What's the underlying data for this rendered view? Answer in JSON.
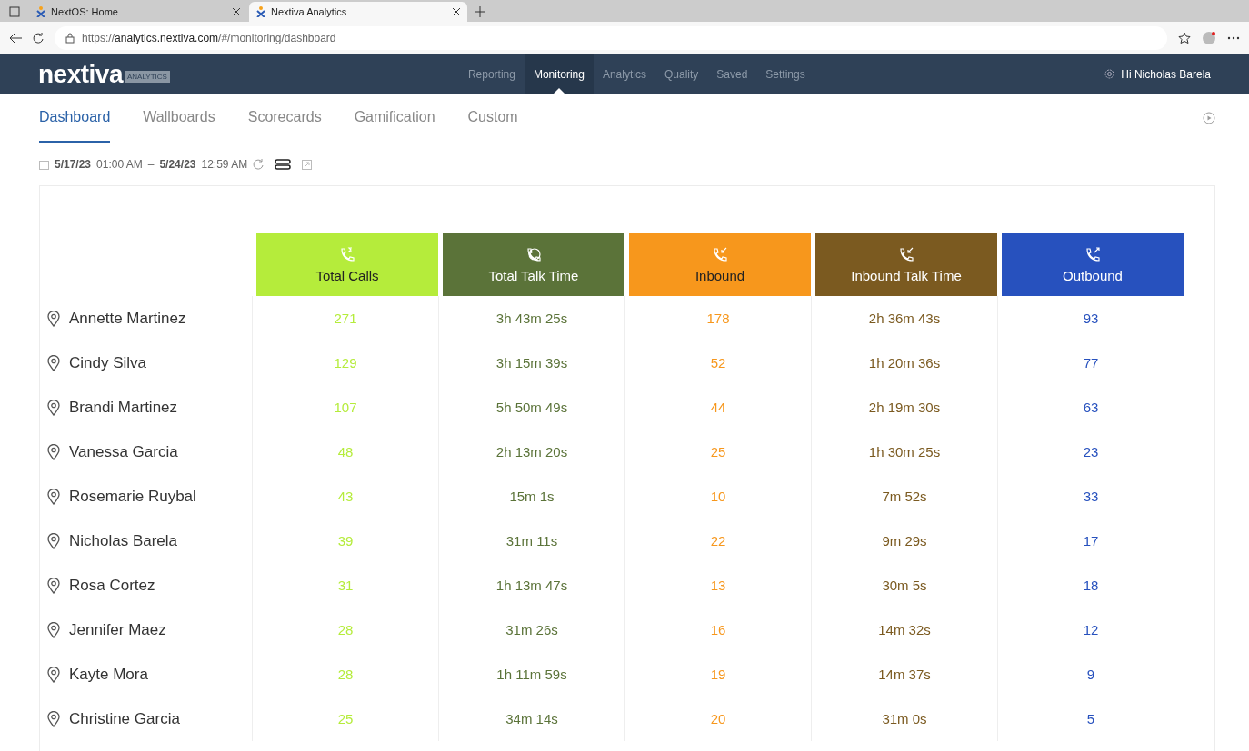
{
  "browser": {
    "tabs": [
      {
        "title": "NextOS: Home",
        "selected": false
      },
      {
        "title": "Nextiva Analytics",
        "selected": true
      }
    ],
    "url_prefix": "https://",
    "url_host": "analytics.nextiva.com",
    "url_path": "/#/monitoring/dashboard"
  },
  "app": {
    "logo": "nextiva",
    "logo_badge": "ANALYTICS",
    "nav": [
      {
        "label": "Reporting",
        "selected": false
      },
      {
        "label": "Monitoring",
        "selected": true
      },
      {
        "label": "Analytics",
        "selected": false
      },
      {
        "label": "Quality",
        "selected": false
      },
      {
        "label": "Saved",
        "selected": false
      },
      {
        "label": "Settings",
        "selected": false
      }
    ],
    "greeting": "Hi Nicholas Barela"
  },
  "subtabs": [
    {
      "label": "Dashboard",
      "selected": true
    },
    {
      "label": "Wallboards",
      "selected": false
    },
    {
      "label": "Scorecards",
      "selected": false
    },
    {
      "label": "Gamification",
      "selected": false
    },
    {
      "label": "Custom",
      "selected": false
    }
  ],
  "date_range": {
    "start_date": "5/17/23",
    "start_time": "01:00 AM",
    "separator": "–",
    "end_date": "5/24/23",
    "end_time": "12:59 AM"
  },
  "columns": [
    {
      "label": "Total Calls",
      "kind": "calls",
      "color": "#b5ec3b"
    },
    {
      "label": "Total Talk Time",
      "kind": "talk",
      "color": "#5b7339"
    },
    {
      "label": "Inbound",
      "kind": "inbound",
      "color": "#f7971c"
    },
    {
      "label": "Inbound Talk Time",
      "kind": "inbound_talk",
      "color": "#7b5a20"
    },
    {
      "label": "Outbound",
      "kind": "outbound",
      "color": "#2751be"
    }
  ],
  "rows": [
    {
      "name": "Annette Martinez",
      "values": [
        "271",
        "3h 43m 25s",
        "178",
        "2h 36m 43s",
        "93"
      ]
    },
    {
      "name": "Cindy Silva",
      "values": [
        "129",
        "3h 15m 39s",
        "52",
        "1h 20m 36s",
        "77"
      ]
    },
    {
      "name": "Brandi Martinez",
      "values": [
        "107",
        "5h 50m 49s",
        "44",
        "2h 19m 30s",
        "63"
      ]
    },
    {
      "name": "Vanessa Garcia",
      "values": [
        "48",
        "2h 13m 20s",
        "25",
        "1h 30m 25s",
        "23"
      ]
    },
    {
      "name": "Rosemarie Ruybal",
      "values": [
        "43",
        "15m 1s",
        "10",
        "7m 52s",
        "33"
      ]
    },
    {
      "name": "Nicholas Barela",
      "values": [
        "39",
        "31m 11s",
        "22",
        "9m 29s",
        "17"
      ]
    },
    {
      "name": "Rosa Cortez",
      "values": [
        "31",
        "1h 13m 47s",
        "13",
        "30m 5s",
        "18"
      ]
    },
    {
      "name": "Jennifer Maez",
      "values": [
        "28",
        "31m 26s",
        "16",
        "14m 32s",
        "12"
      ]
    },
    {
      "name": "Kayte Mora",
      "values": [
        "28",
        "1h 11m 59s",
        "19",
        "14m 37s",
        "9"
      ]
    },
    {
      "name": "Christine Garcia",
      "values": [
        "25",
        "34m 14s",
        "20",
        "31m 0s",
        "5"
      ]
    }
  ]
}
